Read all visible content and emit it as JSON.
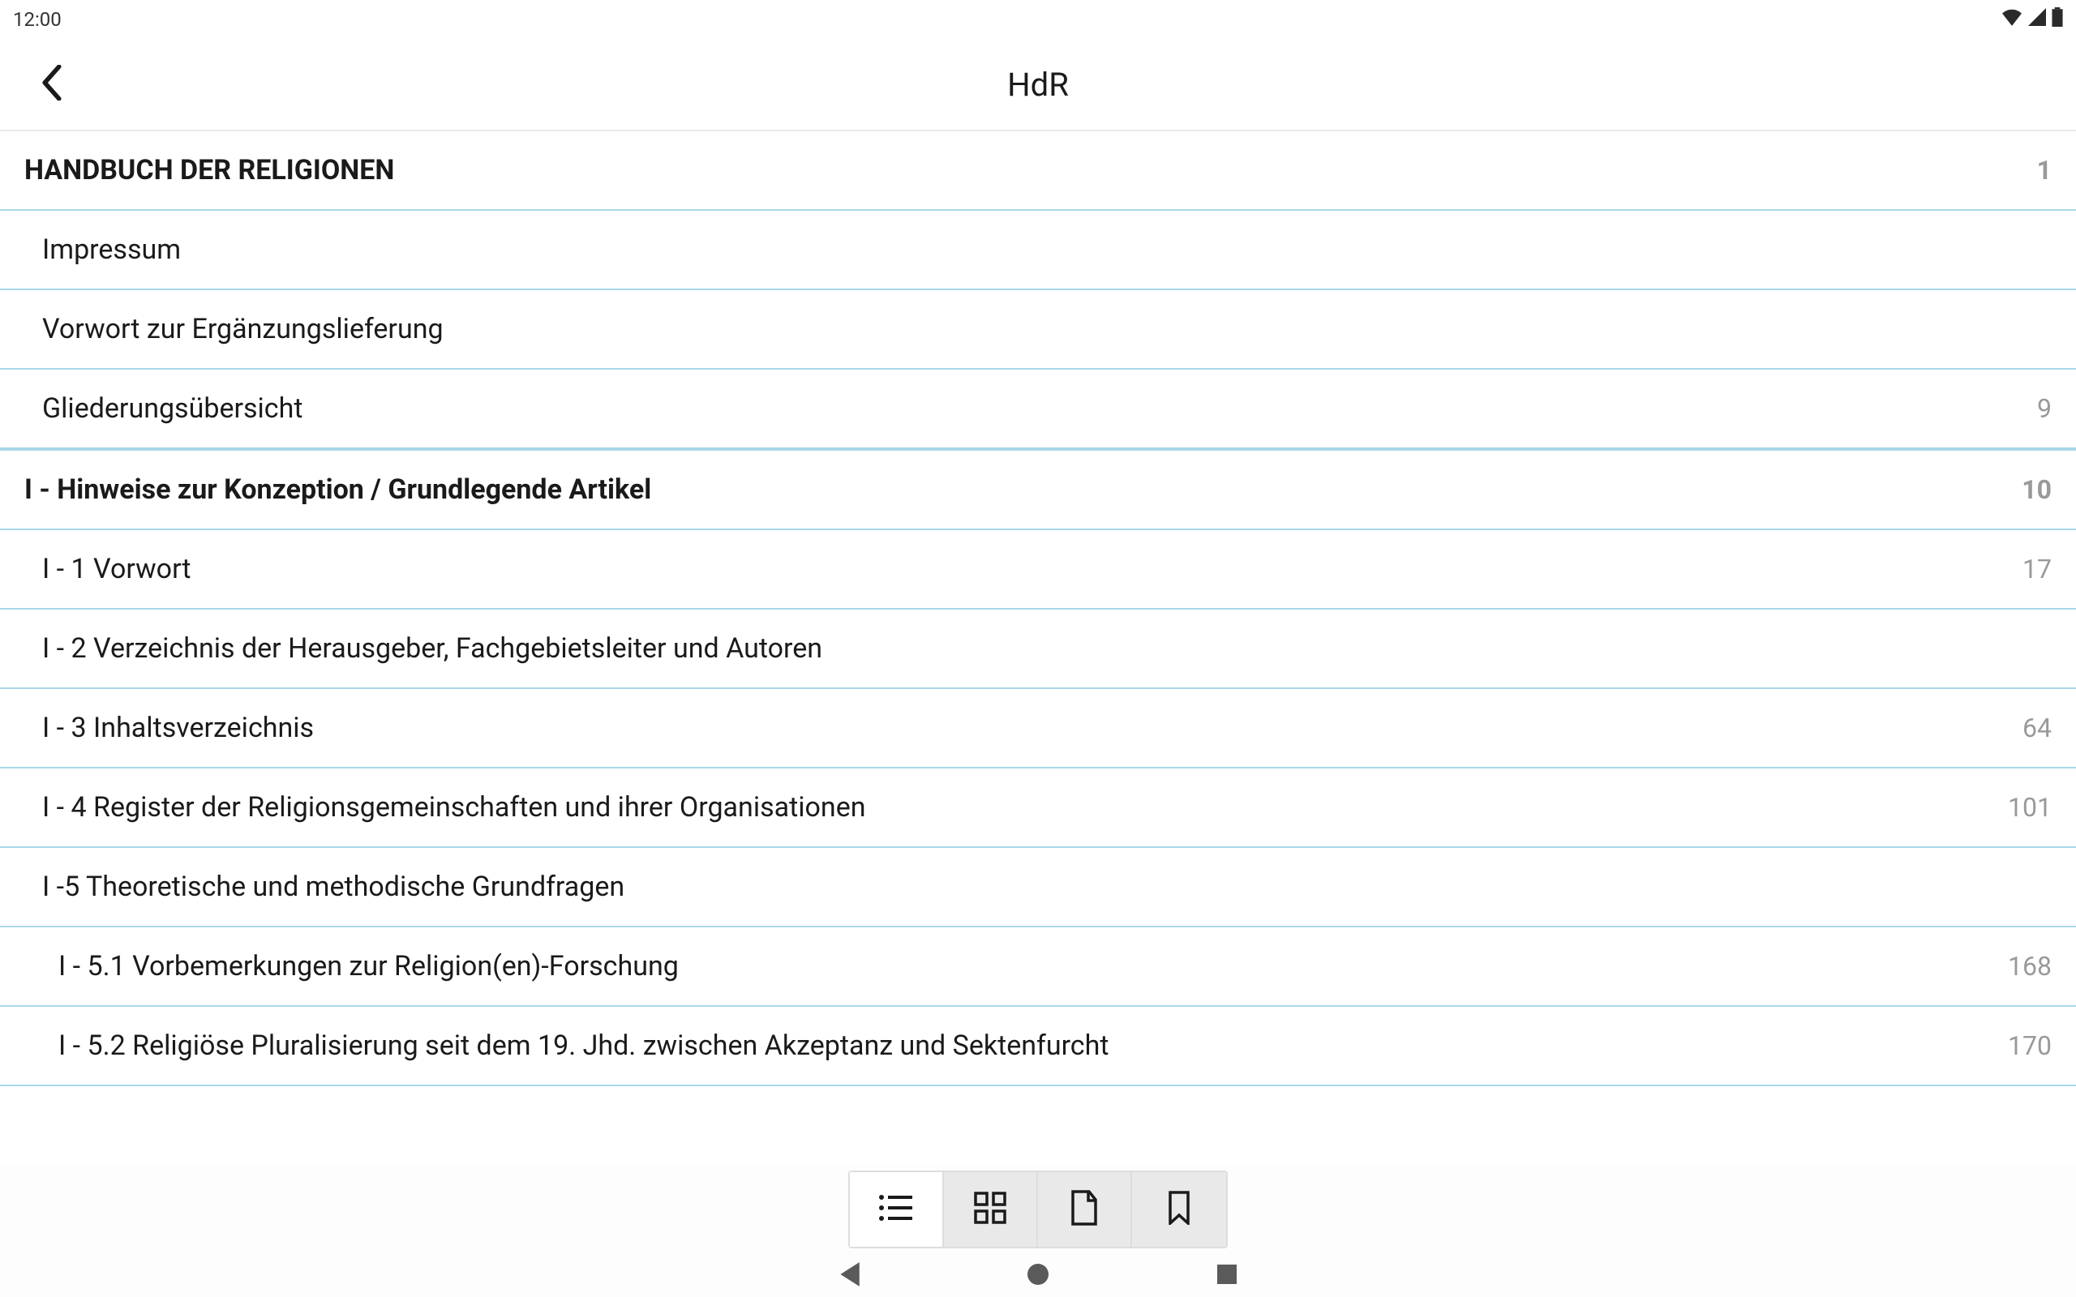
{
  "status": {
    "time": "12:00"
  },
  "header": {
    "title": "HdR"
  },
  "toc": {
    "items": [
      {
        "title": "HANDBUCH DER RELIGIONEN",
        "page": "1",
        "level": 0
      },
      {
        "title": "Impressum",
        "page": "",
        "level": 1
      },
      {
        "title": "Vorwort zur Ergänzungslieferung",
        "page": "",
        "level": 1
      },
      {
        "title": "Gliederungsübersicht",
        "page": "9",
        "level": 1
      },
      {
        "title": "I - Hinweise zur Konzeption / Grundlegende Artikel",
        "page": "10",
        "level": 0
      },
      {
        "title": "I - 1 Vorwort",
        "page": "17",
        "level": 1
      },
      {
        "title": "I - 2 Verzeichnis der Herausgeber, Fachgebietsleiter und Autoren",
        "page": "",
        "level": 1
      },
      {
        "title": "I - 3 Inhaltsverzeichnis",
        "page": "64",
        "level": 1
      },
      {
        "title": "I - 4 Register der Religionsgemeinschaften und ihrer Organisationen",
        "page": "101",
        "level": 1
      },
      {
        "title": "I -5 Theoretische und methodische Grundfragen",
        "page": "",
        "level": 1
      },
      {
        "title": "I - 5.1 Vorbemerkungen zur Religion(en)-Forschung",
        "page": "168",
        "level": 2
      },
      {
        "title": "I - 5.2 Religiöse Pluralisierung seit dem 19. Jhd. zwischen Akzeptanz und Sektenfurcht",
        "page": "170",
        "level": 2
      }
    ]
  }
}
